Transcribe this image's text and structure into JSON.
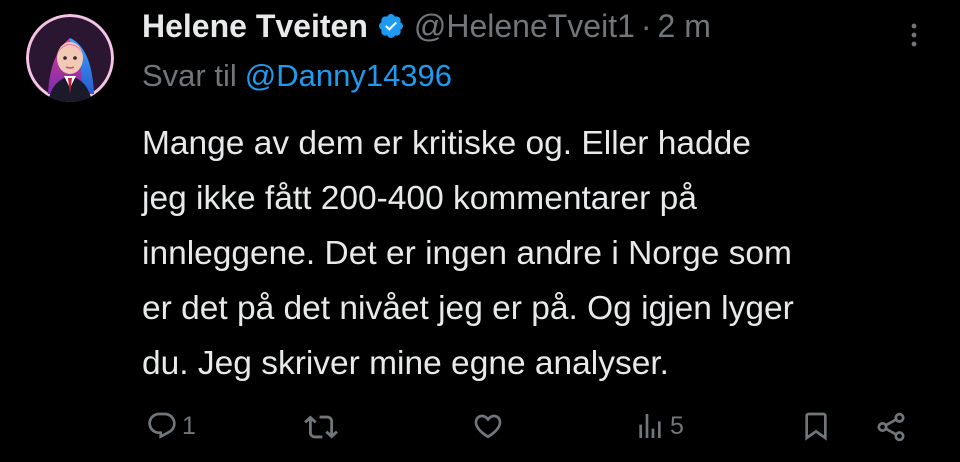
{
  "post": {
    "author": {
      "display_name": "Helene Tveiten",
      "handle": "@HeleneTveit1",
      "verified": true,
      "avatar": "avatar-icon"
    },
    "separator": "·",
    "timestamp": "2 m",
    "reply_to": {
      "prefix": "Svar til",
      "mention": "@Danny14396"
    },
    "text_lines": [
      "Mange av dem er kritiske og. Eller hadde",
      "jeg ikke fått 200-400 kommentarer på",
      "innleggene. Det er ingen andre i Norge som",
      "er det på det nivået jeg er på. Og igjen lyger",
      "du. Jeg skriver mine egne analyser."
    ]
  },
  "actions": {
    "reply": {
      "icon": "reply-icon",
      "count": "1"
    },
    "repost": {
      "icon": "repost-icon"
    },
    "like": {
      "icon": "heart-icon"
    },
    "views": {
      "icon": "views-icon",
      "count": "5"
    },
    "bookmark": {
      "icon": "bookmark-icon"
    },
    "share": {
      "icon": "share-icon"
    }
  },
  "colors": {
    "background": "#000000",
    "primary_text": "#e7e9ea",
    "secondary_text": "#71767b",
    "accent": "#1d9bf0"
  }
}
